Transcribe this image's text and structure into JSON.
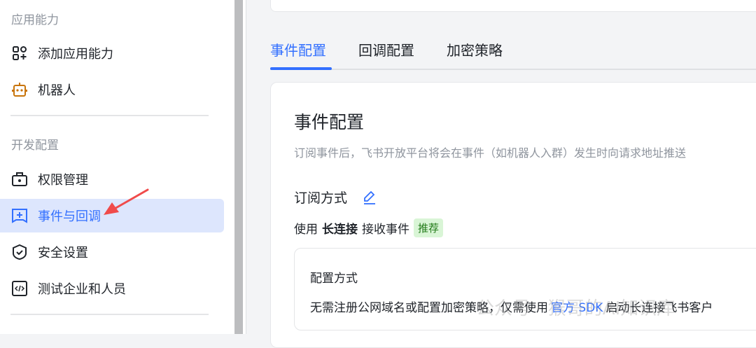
{
  "sidebar": {
    "section1": "应用能力",
    "section2": "开发配置",
    "items": [
      {
        "label": "添加应用能力",
        "icon": "apps-add-icon"
      },
      {
        "label": "机器人",
        "icon": "robot-icon"
      },
      {
        "label": "权限管理",
        "icon": "permission-icon"
      },
      {
        "label": "事件与回调",
        "icon": "event-icon",
        "active": true
      },
      {
        "label": "安全设置",
        "icon": "shield-icon"
      },
      {
        "label": "测试企业和人员",
        "icon": "code-icon"
      }
    ]
  },
  "tabs": [
    {
      "label": "事件配置",
      "active": true
    },
    {
      "label": "回调配置"
    },
    {
      "label": "加密策略"
    }
  ],
  "card": {
    "title": "事件配置",
    "description": "订阅事件后，飞书开放平台将会在事件（如机器人入群）发生时向请求地址推送",
    "subscribe_label": "订阅方式",
    "mode_prefix": "使用",
    "mode_bold": "长连接",
    "mode_suffix": "接收事件",
    "tag": "推荐",
    "config_title": "配置方式",
    "config_text_before": "无需注册公网域名或配置加密策略，仅需使用",
    "config_link": "官方 SDK",
    "config_text_after": "启动长连接飞书客户"
  },
  "watermark": "公众号 · 猴哥的AI知识库",
  "colors": {
    "accent": "#3370ff",
    "active_bg": "#dde6fd",
    "tag_bg": "#d9f5d6",
    "arrow": "#f04b4b"
  }
}
